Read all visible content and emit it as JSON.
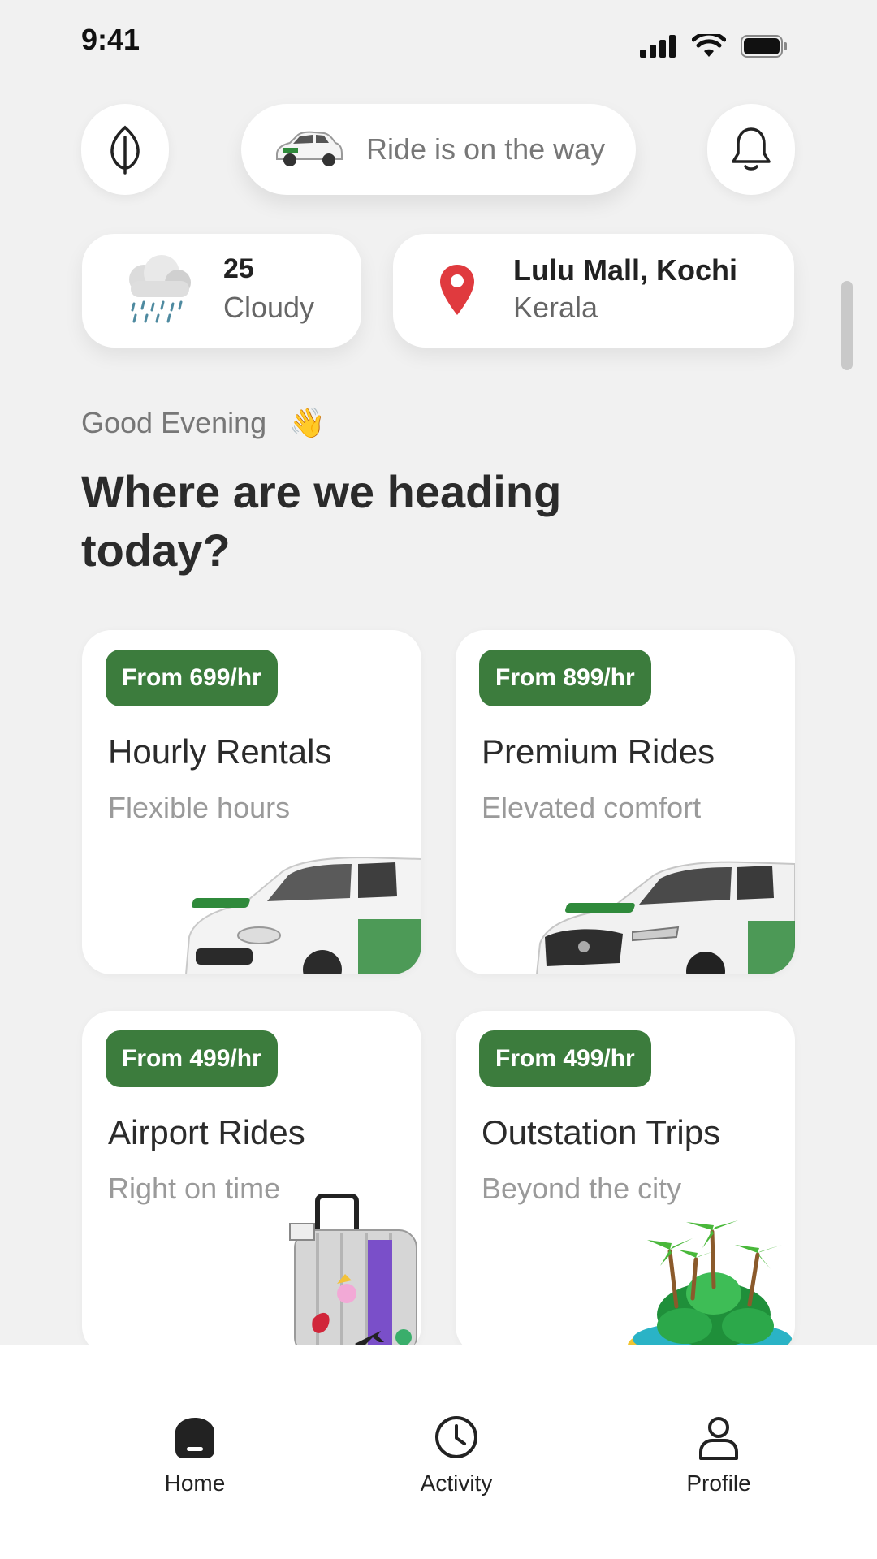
{
  "status_bar": {
    "time": "9:41"
  },
  "header": {
    "ride_status": "Ride is on the way"
  },
  "weather": {
    "temperature": "25",
    "condition": "Cloudy"
  },
  "location": {
    "place": "Lulu Mall, Kochi",
    "region": "Kerala"
  },
  "greeting": {
    "text": "Good Evening",
    "emoji": "👋"
  },
  "headline": "Where are we heading today?",
  "services": [
    {
      "price": "From 699/hr",
      "title": "Hourly Rentals",
      "subtitle": "Flexible hours"
    },
    {
      "price": "From 899/hr",
      "title": "Premium Rides",
      "subtitle": "Elevated comfort"
    },
    {
      "price": "From 499/hr",
      "title": "Airport Rides",
      "subtitle": "Right on time"
    },
    {
      "price": "From 499/hr",
      "title": "Outstation Trips",
      "subtitle": "Beyond the city"
    }
  ],
  "nav": [
    {
      "label": "Home",
      "icon": "home-icon",
      "active": true
    },
    {
      "label": "Activity",
      "icon": "clock-icon"
    },
    {
      "label": "Profile",
      "icon": "user-icon"
    }
  ],
  "colors": {
    "accent": "#3c7c3d",
    "background": "#f1f1f1",
    "card": "#ffffff"
  }
}
